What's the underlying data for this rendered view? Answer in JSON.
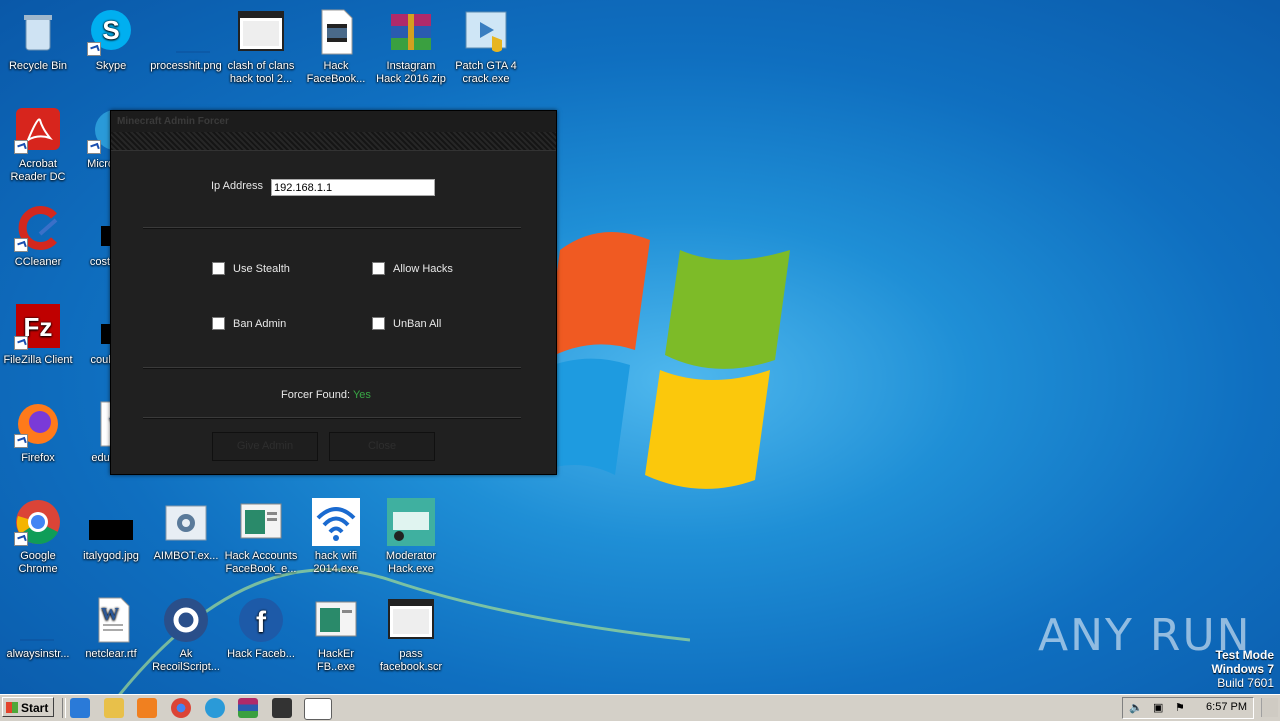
{
  "desktop": {
    "icons": [
      {
        "label": "Recycle Bin"
      },
      {
        "label": "Skype"
      },
      {
        "label": "processhit.png"
      },
      {
        "label": "clash of clans hack tool 2..."
      },
      {
        "label": "Hack FaceBook..."
      },
      {
        "label": "Instagram Hack 2016.zip"
      },
      {
        "label": "Patch GTA 4 crack.exe"
      },
      {
        "label": "Acrobat Reader DC"
      },
      {
        "label": "Microso..."
      },
      {
        "label": "CCleaner"
      },
      {
        "label": "costsw..."
      },
      {
        "label": "FileZilla Client"
      },
      {
        "label": "coulds..."
      },
      {
        "label": "Firefox"
      },
      {
        "label": "educa..."
      },
      {
        "label": "Google Chrome"
      },
      {
        "label": "italygod.jpg"
      },
      {
        "label": "AIMBOT.ex..."
      },
      {
        "label": "Hack Accounts FaceBook_e..."
      },
      {
        "label": "hack wifi 2014.exe"
      },
      {
        "label": "Moderator Hack.exe"
      },
      {
        "label": "alwaysinstr..."
      },
      {
        "label": "netclear.rtf"
      },
      {
        "label": "Ak RecoilScript..."
      },
      {
        "label": "Hack Faceb..."
      },
      {
        "label": "HackEr FB..exe"
      },
      {
        "label": "pass facebook.scr"
      }
    ]
  },
  "dialog": {
    "title": "Minecraft Admin Forcer",
    "ip_label": "Ip Address",
    "ip_value": "192.168.1.1",
    "checkboxes": {
      "use_stealth": "Use Stealth",
      "allow_hacks": "Allow Hacks",
      "ban_admin": "Ban Admin",
      "unban_all": "UnBan All"
    },
    "found_label": "Forcer Found:",
    "found_value": "Yes",
    "give_admin": "Give Admin",
    "close": "Close"
  },
  "watermark": "ANY RUN",
  "testmode": {
    "line1": "Test Mode",
    "line2": "Windows 7",
    "line3": "Build 7601"
  },
  "taskbar": {
    "start": "Start",
    "clock": "6:57 PM"
  },
  "colors": {
    "found_yes": "#39a845",
    "desktop_blue": "#1f8fd6"
  }
}
